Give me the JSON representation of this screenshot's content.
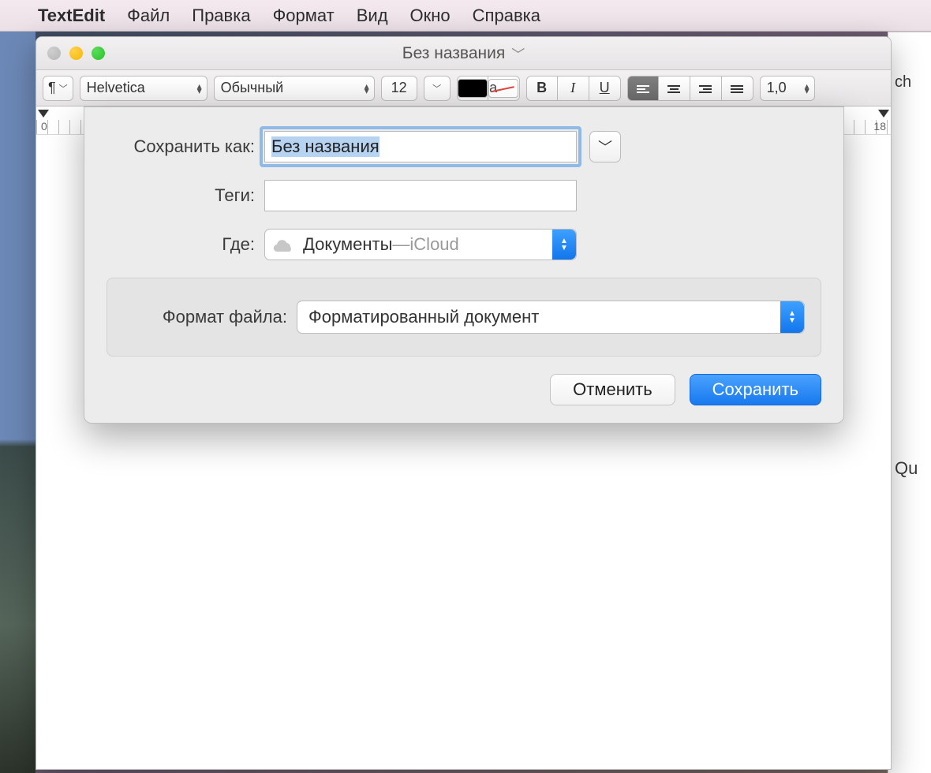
{
  "menubar": {
    "app": "TextEdit",
    "items": [
      "Файл",
      "Правка",
      "Формат",
      "Вид",
      "Окно",
      "Справка"
    ]
  },
  "window": {
    "title": "Без названия"
  },
  "toolbar": {
    "paragraph_glyph": "¶",
    "font": "Helvetica",
    "style": "Обычный",
    "size": "12",
    "strike_letter": "a",
    "bold": "B",
    "italic": "I",
    "underline": "U",
    "spacing": "1,0"
  },
  "ruler": {
    "start": "0",
    "end": "18"
  },
  "save_dialog": {
    "save_as_label": "Сохранить как:",
    "filename": "Без названия",
    "tags_label": "Теги:",
    "tags_value": "",
    "where_label": "Где:",
    "where_folder": "Документы",
    "where_separator": " — ",
    "where_service": "iCloud",
    "format_label": "Формат файла:",
    "format_value": "Форматированный документ",
    "cancel": "Отменить",
    "save": "Сохранить"
  },
  "background_fragments": {
    "a": "ch",
    "b": "Qu"
  }
}
